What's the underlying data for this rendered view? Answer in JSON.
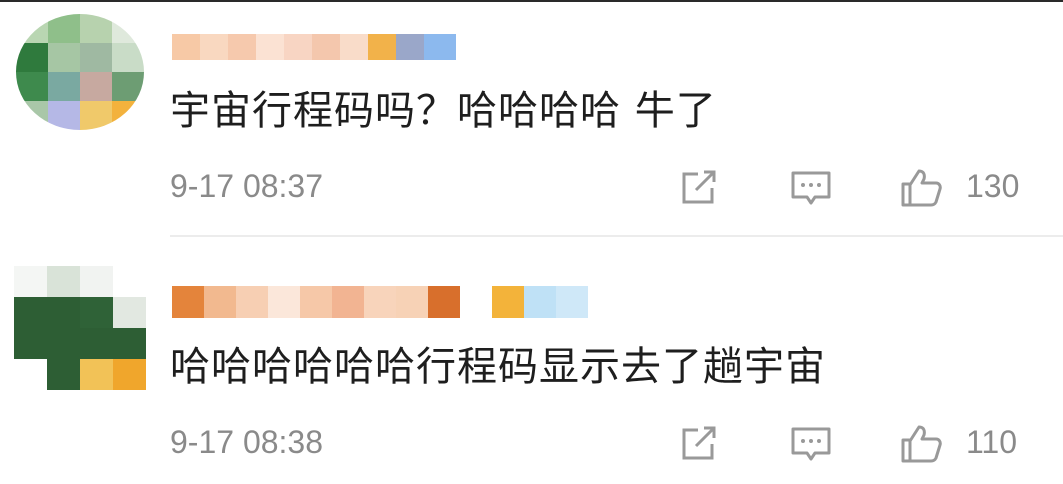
{
  "comments": [
    {
      "text": "宇宙行程码吗？哈哈哈哈 牛了",
      "time": "9-17 08:37",
      "likes": "130",
      "icons": [
        "share-icon",
        "reply-icon",
        "like-icon"
      ]
    },
    {
      "text": "哈哈哈哈哈哈行程码显示去了趟宇宙",
      "time": "9-17 08:38",
      "likes": "110",
      "icons": [
        "share-icon",
        "reply-icon",
        "like-icon"
      ]
    }
  ],
  "colors": {
    "text": "#1e1e1e",
    "meta": "#8a8a8a",
    "divider": "#ececec"
  }
}
